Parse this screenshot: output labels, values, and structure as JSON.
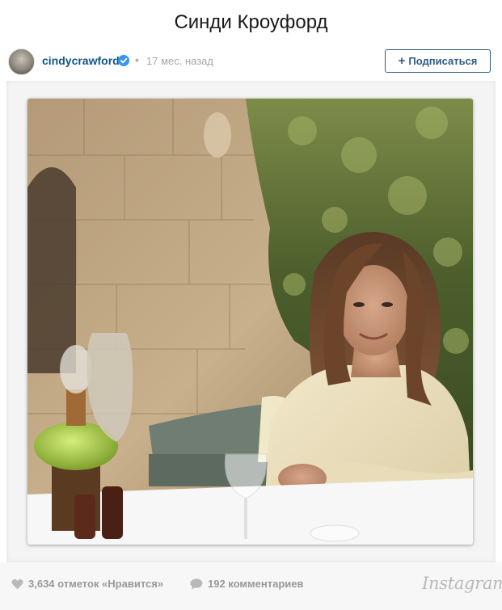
{
  "page": {
    "title": "Синди Кроуфорд"
  },
  "post": {
    "username": "cindycrawford",
    "verified_icon": "verified-badge-icon",
    "time_ago": "17 мес. назад",
    "follow_label": "Подписаться",
    "likes_text": "3,634 отметок «Нравится»",
    "comments_text": "192 комментариев",
    "brand": "Instagram"
  },
  "colors": {
    "username": "#125688",
    "verified": "#3897f0",
    "follow_border": "#2f5b83",
    "meta_gray": "#a5a7aa"
  }
}
